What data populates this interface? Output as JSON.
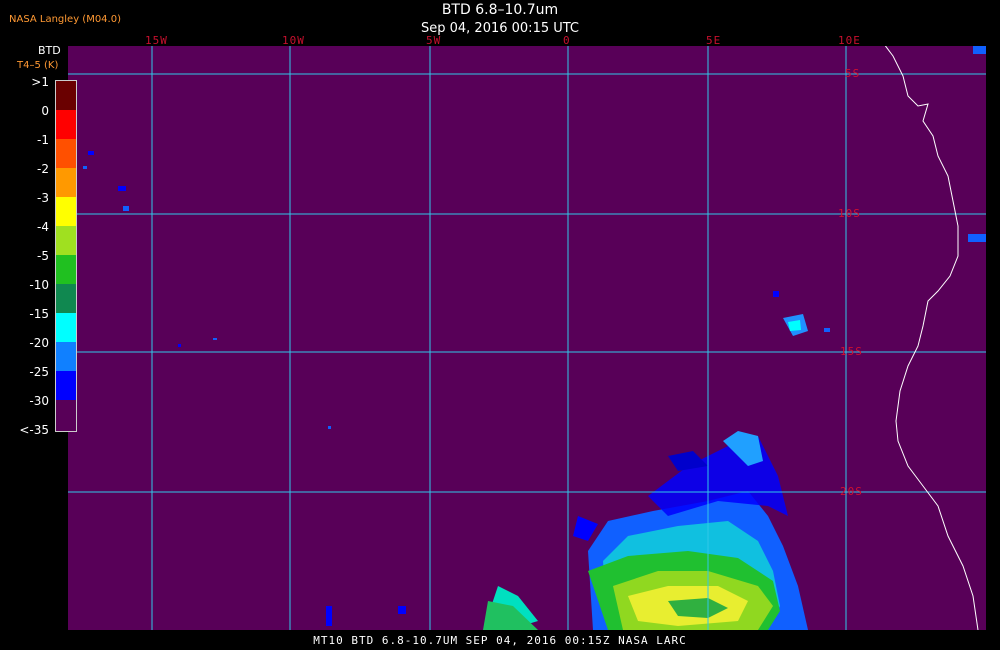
{
  "header": {
    "producer": "NASA Langley (M04.0)",
    "title": "BTD 6.8–10.7um",
    "subtitle": "Sep 04, 2016 00:15 UTC"
  },
  "legend": {
    "title": "BTD",
    "unit": "T4–5 (K)",
    "labels": [
      ">1",
      "0",
      "-1",
      "-2",
      "-3",
      "-4",
      "-5",
      "-10",
      "-15",
      "-20",
      "-25",
      "-30",
      "<-35"
    ],
    "colors": [
      "#6a0000",
      "#ff0000",
      "#ff5000",
      "#ff9900",
      "#ffff00",
      "#a0e020",
      "#20c020",
      "#108850",
      "#00ffff",
      "#1080ff",
      "#0000ff",
      "#580058"
    ]
  },
  "map": {
    "longitude_labels": [
      "15W",
      "10W",
      "5W",
      "0",
      "5E",
      "10E"
    ],
    "latitude_labels": [
      "5S",
      "10S",
      "15S",
      "20S"
    ],
    "background_color": "#580058",
    "grid_color": "#30c8e8",
    "coast_color": "#ffffff"
  },
  "footer": {
    "text": "MT10  BTD 6.8-10.7UM   SEP 04, 2016 00:15Z  NASA LARC"
  }
}
